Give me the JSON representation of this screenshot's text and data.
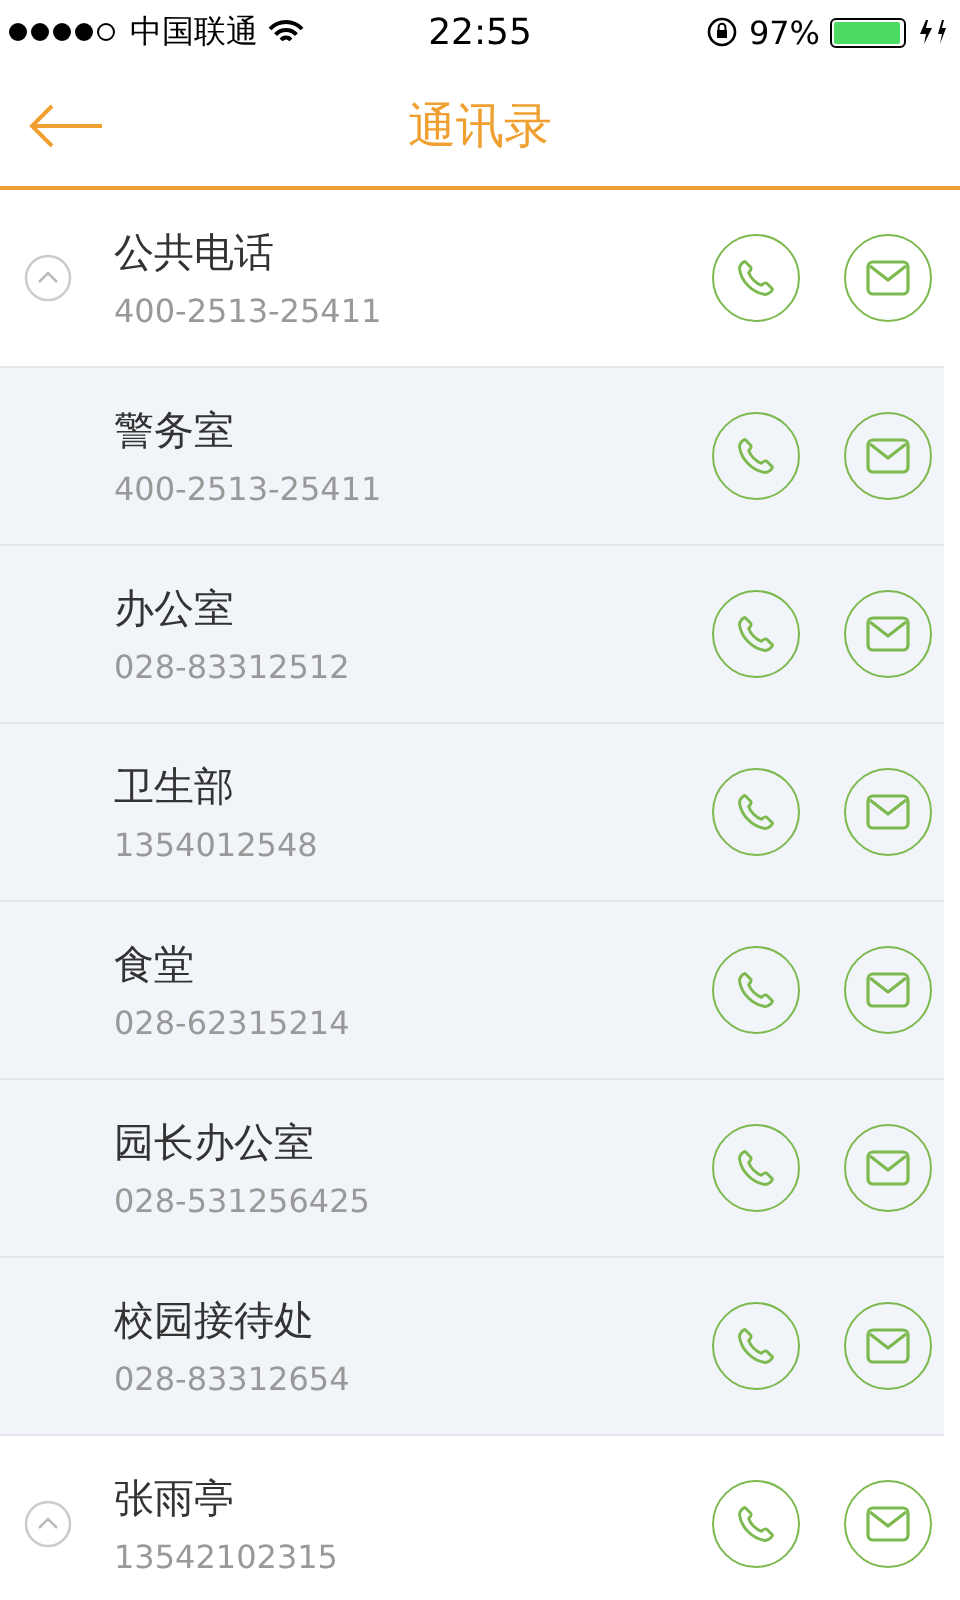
{
  "status_bar": {
    "carrier": "中国联通",
    "time": "22:55",
    "battery_text": "97%",
    "battery": {
      "level": 0.97
    }
  },
  "header": {
    "title": "通讯录"
  },
  "groups": [
    {
      "name": "公共电话",
      "number": "400-2513-25411",
      "expanded": true,
      "children": [
        {
          "name": "警务室",
          "number": "400-2513-25411"
        },
        {
          "name": "办公室",
          "number": "028-83312512"
        },
        {
          "name": "卫生部",
          "number": "1354012548"
        },
        {
          "name": "食堂",
          "number": "028-62315214"
        },
        {
          "name": "园长办公室",
          "number": "028-531256425"
        },
        {
          "name": "校园接待处",
          "number": "028-83312654"
        }
      ]
    },
    {
      "name": "张雨亭",
      "number": "13542102315",
      "expanded": true
    }
  ]
}
